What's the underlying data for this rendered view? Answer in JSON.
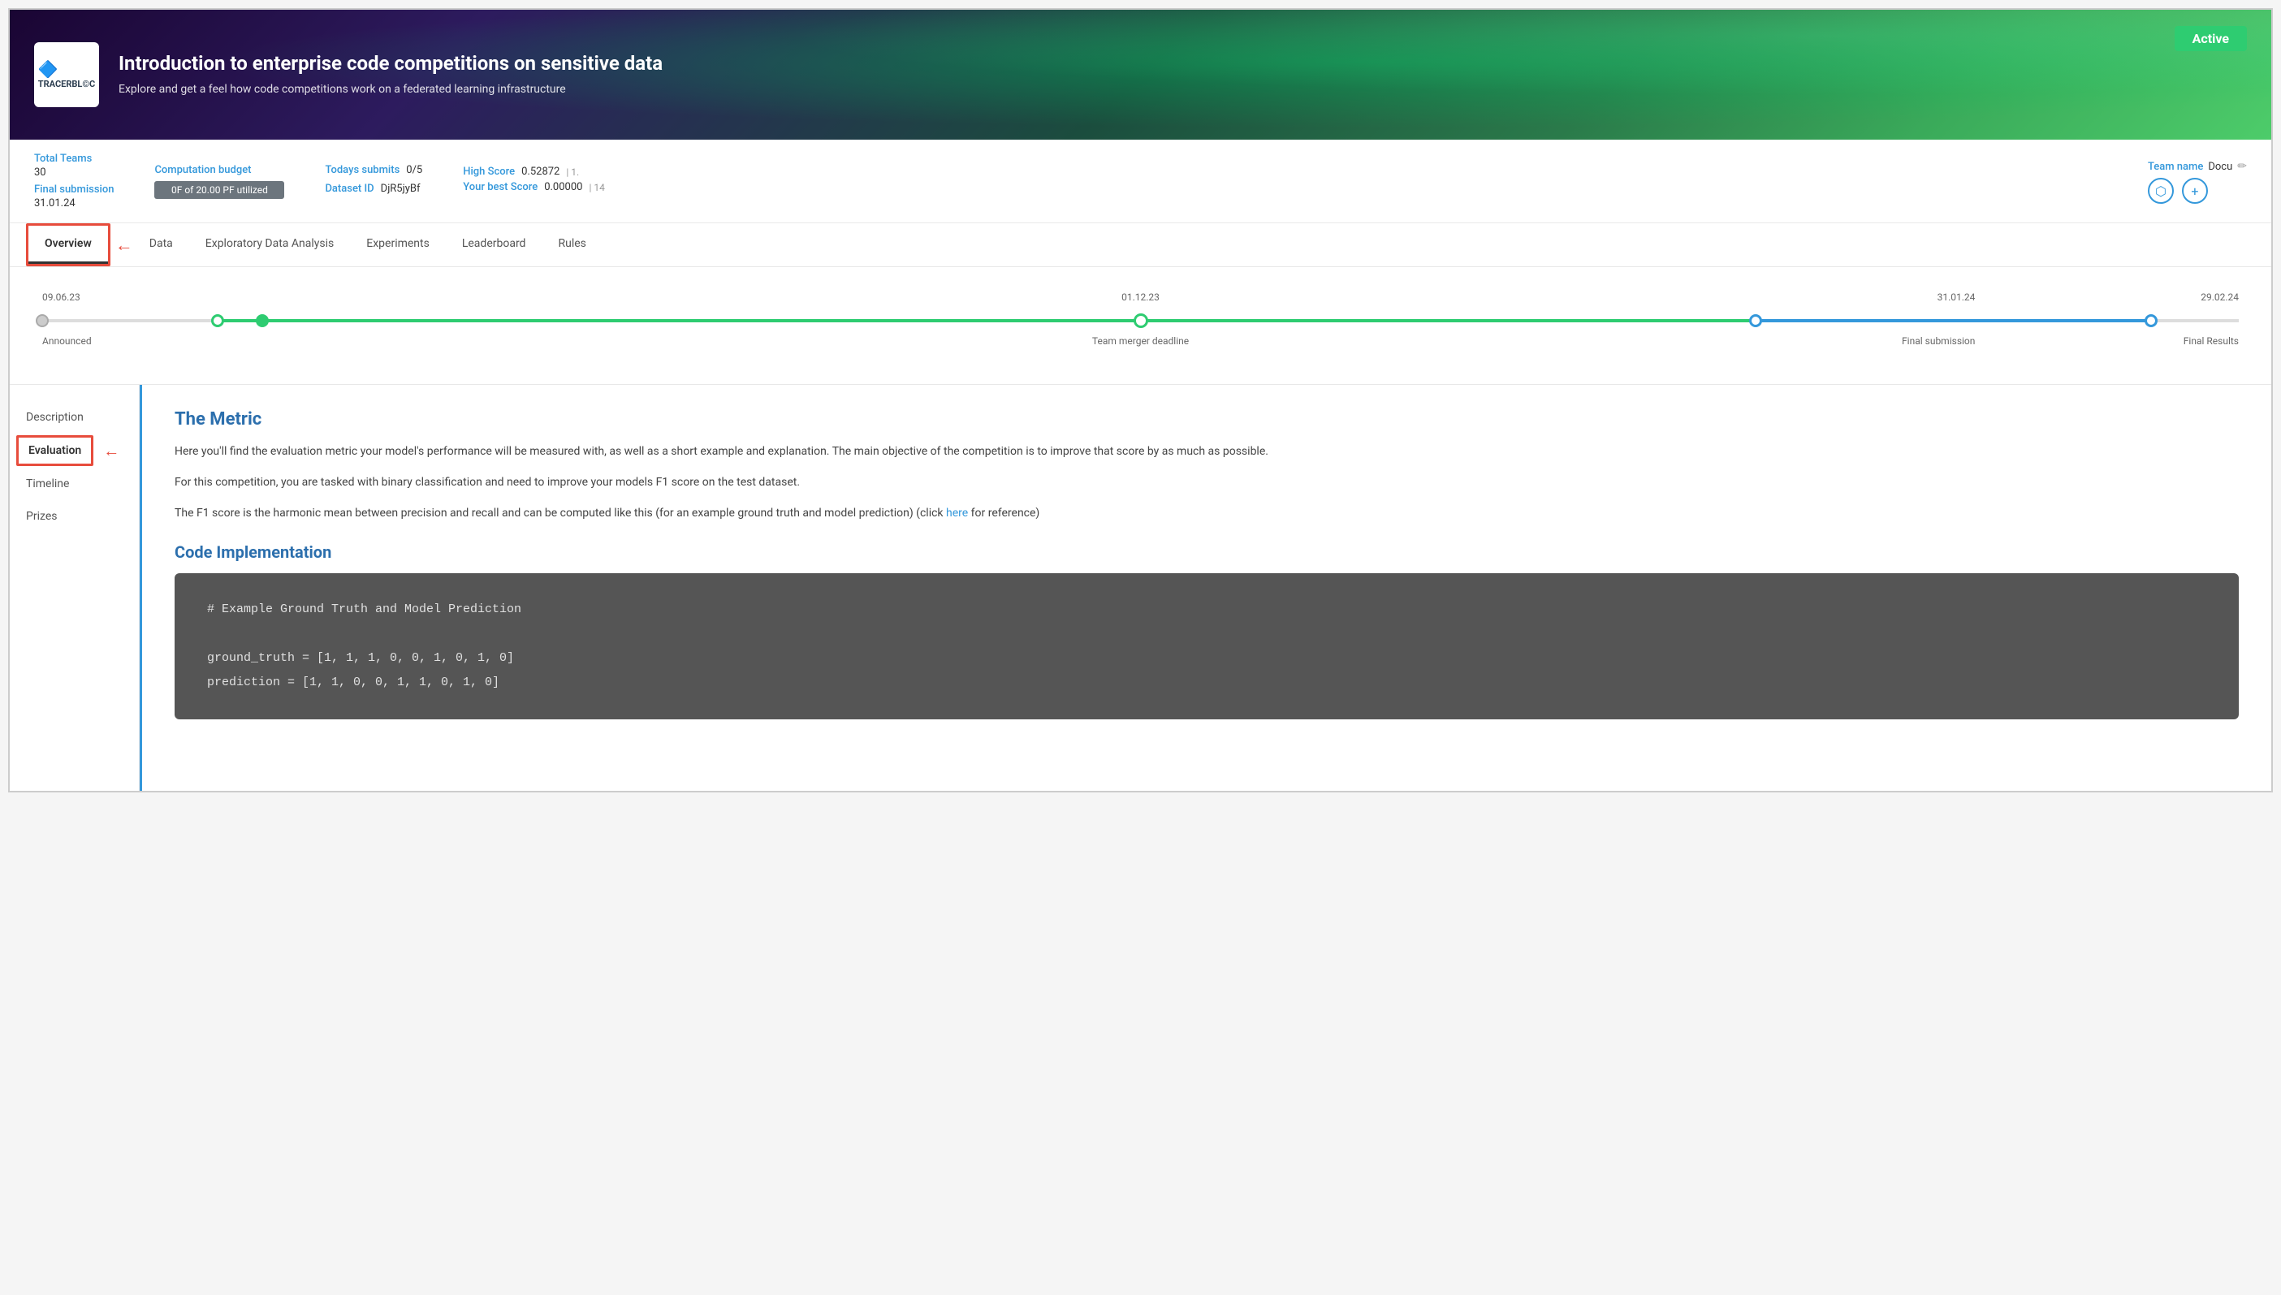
{
  "hero": {
    "title": "Introduction to enterprise code competitions on sensitive data",
    "subtitle": "Explore and get a feel how code competitions work on a federated learning infrastructure",
    "status_badge": "Active",
    "logo_text": "TRACERBL©C"
  },
  "stats": {
    "total_teams_label": "Total Teams",
    "total_teams_value": "30",
    "final_submission_label": "Final submission",
    "final_submission_value": "31.01.24",
    "computation_budget_label": "Computation budget",
    "budget_bar_text": "0F of 20.00 PF utilized",
    "todays_submits_label": "Todays submits",
    "todays_submits_value": "0/5",
    "dataset_id_label": "Dataset ID",
    "dataset_id_value": "DjR5jyBf",
    "high_score_label": "High Score",
    "high_score_value": "0.52872",
    "high_score_rank": "1.",
    "your_best_score_label": "Your best Score",
    "your_best_score_value": "0.00000",
    "your_best_score_rank": "14",
    "team_name_label": "Team name",
    "team_name_value": "Docu"
  },
  "tabs": [
    {
      "label": "Overview",
      "active": true
    },
    {
      "label": "Data",
      "active": false
    },
    {
      "label": "Exploratory Data Analysis",
      "active": false
    },
    {
      "label": "Experiments",
      "active": false
    },
    {
      "label": "Leaderboard",
      "active": false
    },
    {
      "label": "Rules",
      "active": false
    }
  ],
  "timeline": {
    "dates": [
      "09.06.23",
      "",
      "01.12.23",
      "31.01.24",
      "29.02.24"
    ],
    "labels": [
      "Announced",
      "",
      "Team merger deadline",
      "Final submission",
      "Final Results"
    ]
  },
  "sidebar_nav": [
    {
      "label": "Description",
      "active": false
    },
    {
      "label": "Evaluation",
      "active": true
    },
    {
      "label": "Timeline",
      "active": false
    },
    {
      "label": "Prizes",
      "active": false
    }
  ],
  "content": {
    "metric_title": "The Metric",
    "metric_p1": "Here you'll find the evaluation metric your model's performance will be measured with, as well as a short example and explanation. The main objective of the competition is to improve that score by as much as possible.",
    "metric_p2": "For this competition, you are tasked with binary classification and need to improve your models F1 score on the test dataset.",
    "metric_p3_before": "The F1 score is the harmonic mean between precision and recall and can be computed like this (for an example ground truth and model prediction) (click ",
    "metric_p3_link": "here",
    "metric_p3_after": " for reference)",
    "code_title": "Code Implementation",
    "code_lines": [
      "# Example Ground Truth and Model Prediction",
      "",
      "ground_truth = [1, 1, 1, 0, 0, 1, 0, 1, 0]",
      "prediction = [1, 1, 0, 0, 1, 1, 0, 1, 0]"
    ]
  },
  "icons": {
    "edit": "✏",
    "nodes": "⬡",
    "plus": "+"
  }
}
